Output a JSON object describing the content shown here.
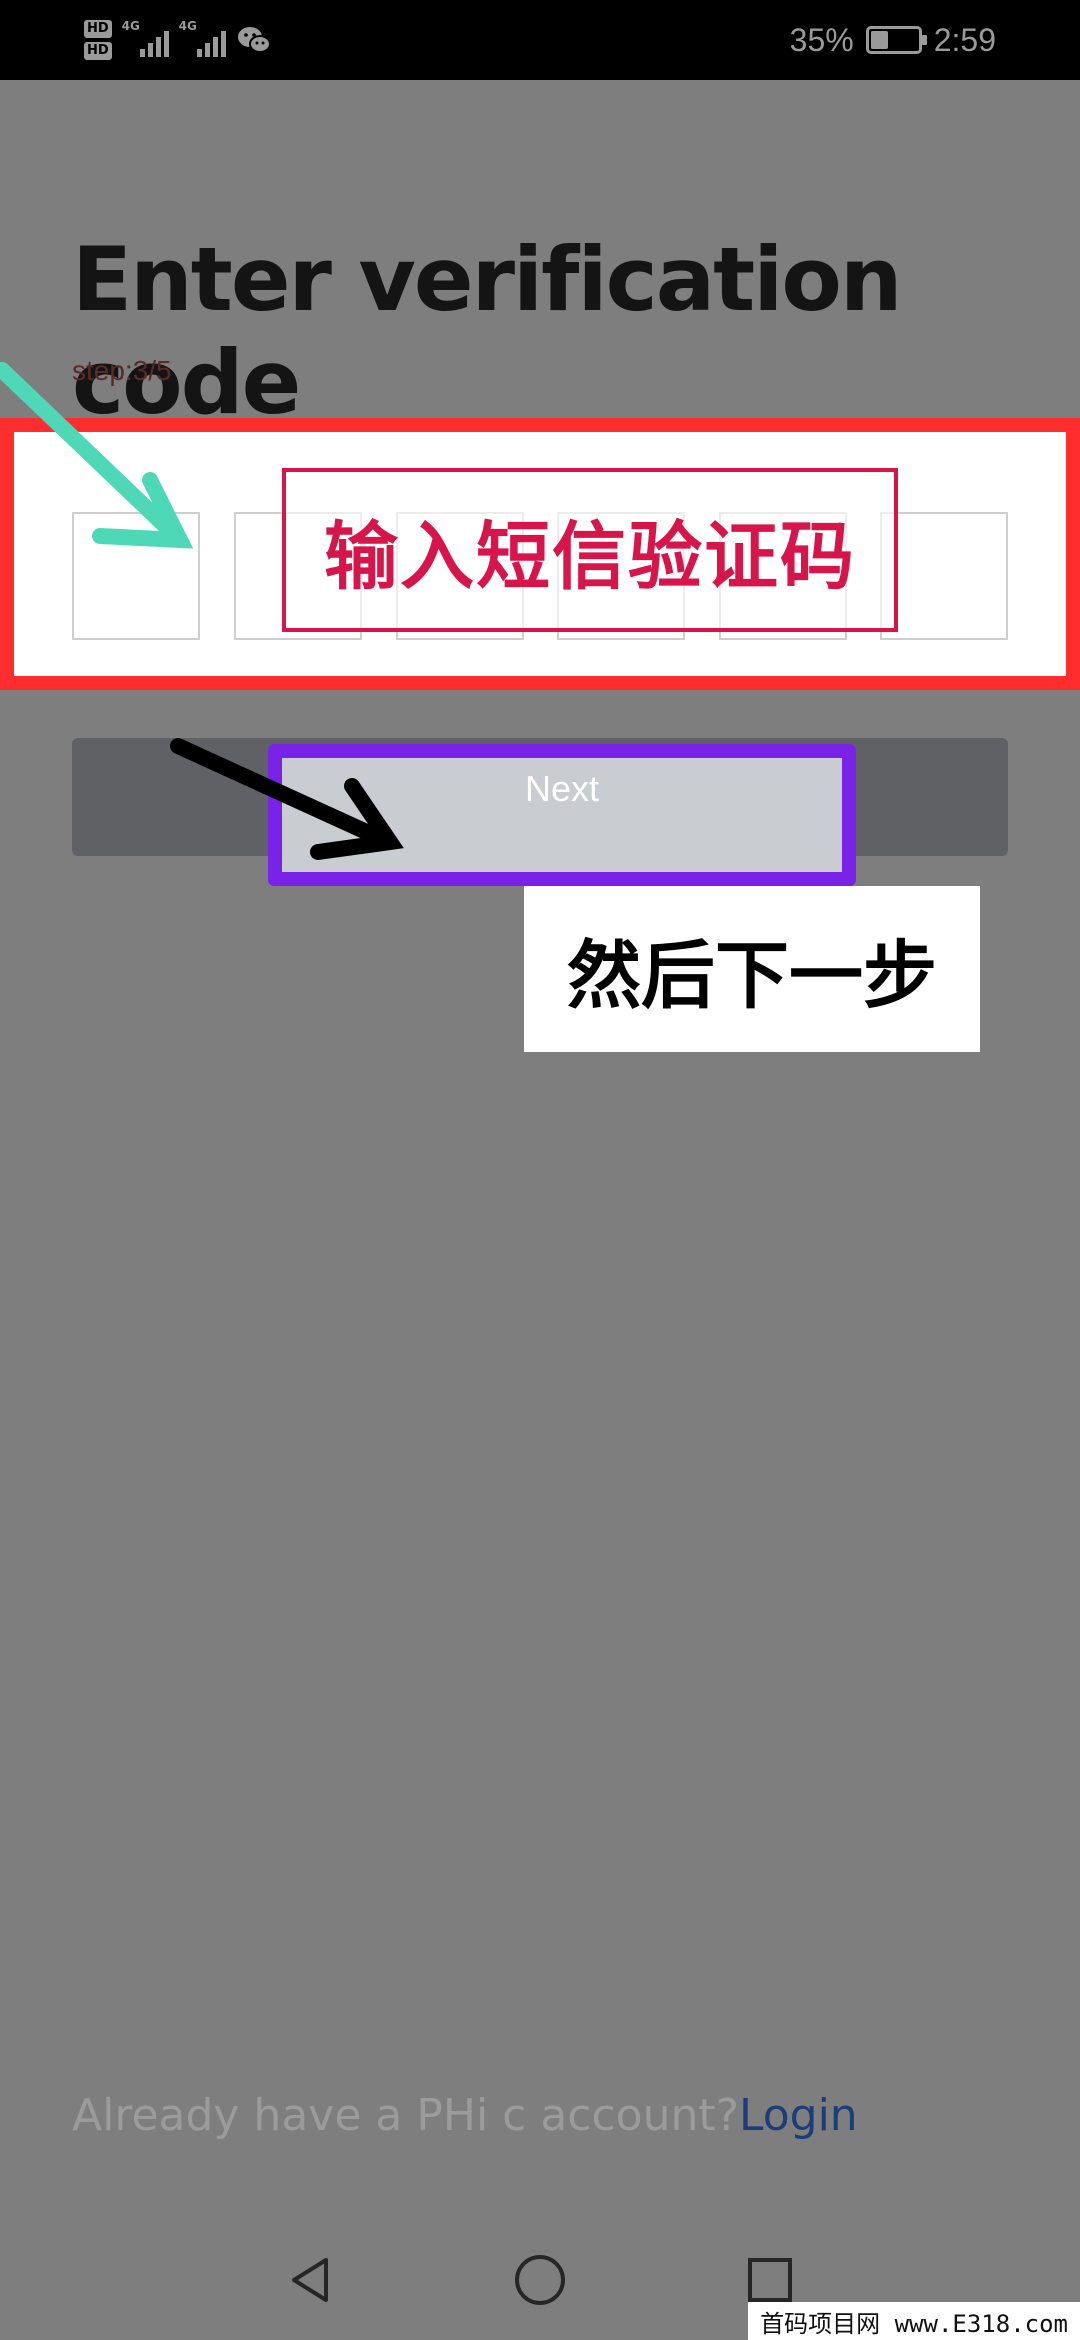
{
  "status_bar": {
    "badge_1": "HD",
    "badge_2": "HD",
    "network_1": "4G",
    "network_2": "4G",
    "battery": "35%",
    "battery_level": 0.35,
    "time": "2:59",
    "icons": [
      "signal-icon",
      "wechat-icon",
      "battery-icon"
    ]
  },
  "page": {
    "title": "Enter verification code",
    "step": "step:3/5"
  },
  "code_input": {
    "box_count": 6,
    "annotation": "输入短信验证码"
  },
  "next": {
    "label": "Next",
    "annotation": "然后下一步"
  },
  "footer": {
    "question": "Already have a PHi c account?",
    "login": "Login"
  },
  "nav": {
    "icons": [
      "back-icon",
      "home-icon",
      "recents-icon"
    ]
  },
  "watermark": "首码项目网 www.E318.com",
  "colors": {
    "overlay": "#7e7e7e",
    "panel_border": "#ff2d2d",
    "banner": "#d7154a",
    "next_border": "#7a23e8",
    "arrow_teal": "#4fd8b8",
    "link": "#1d3d7a"
  }
}
